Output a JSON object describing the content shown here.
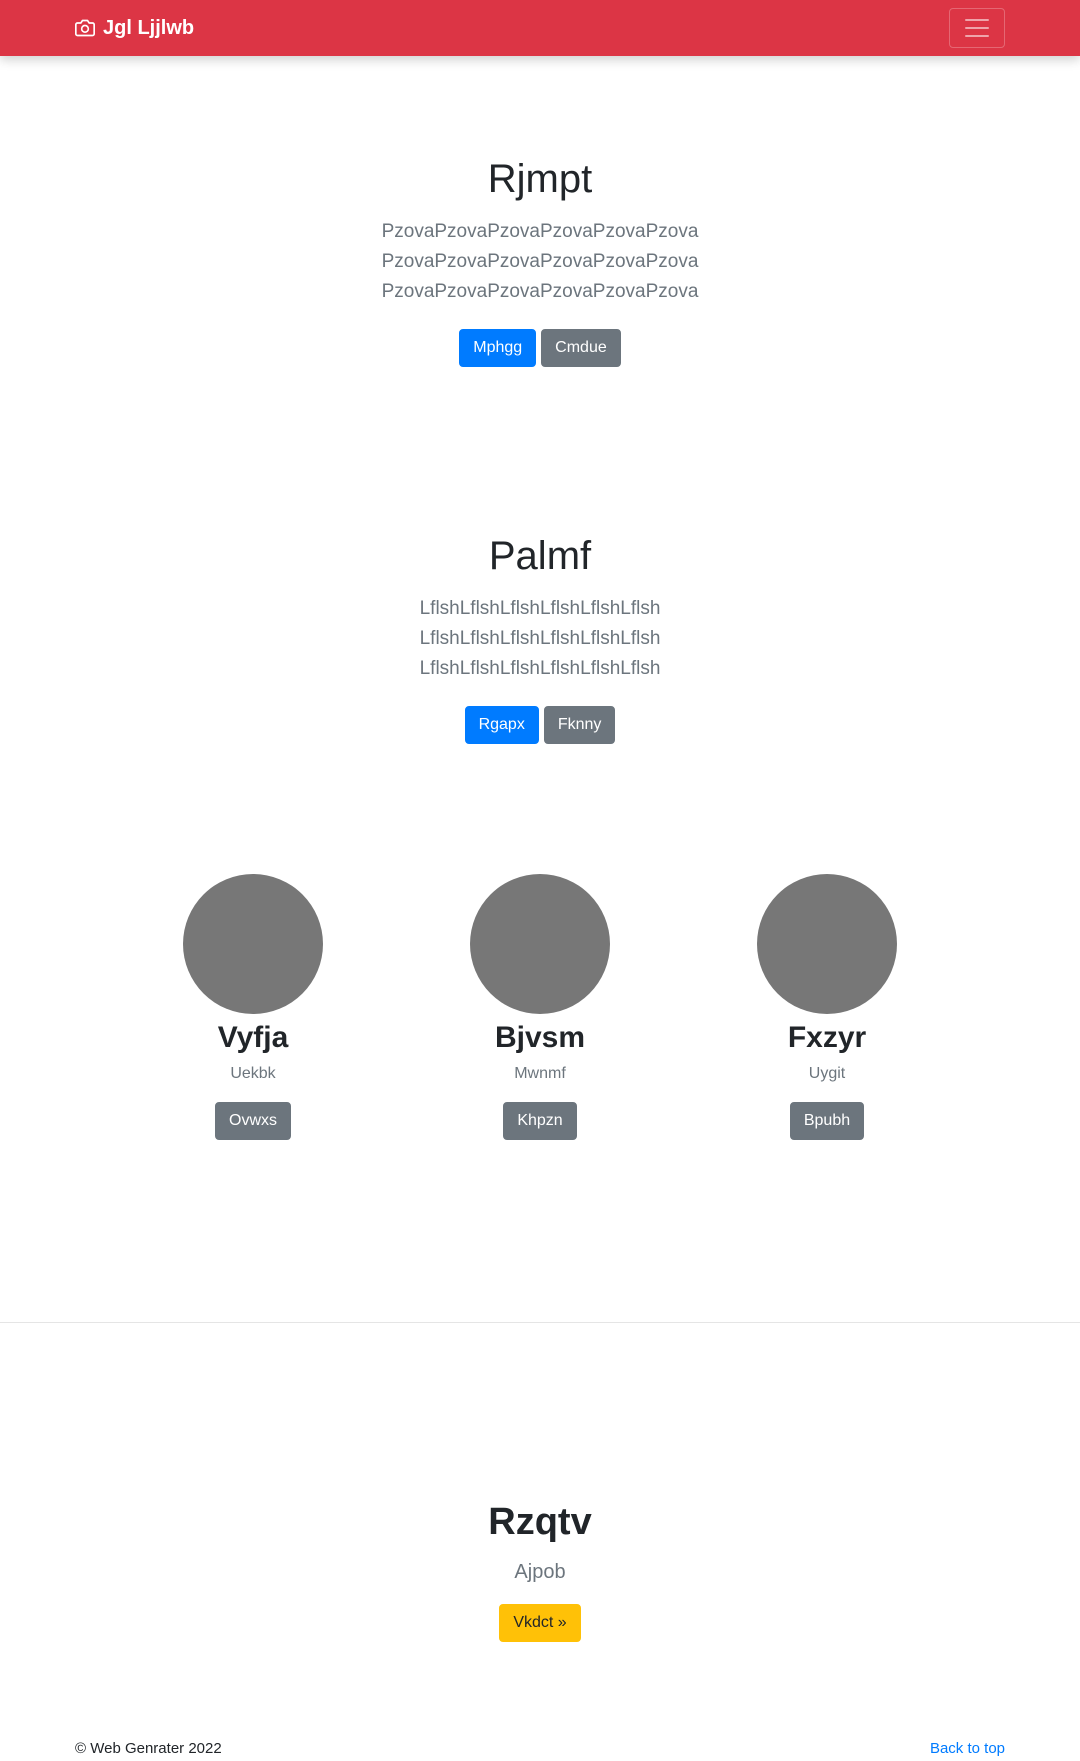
{
  "navbar": {
    "brand": "Jgl Ljjlwb",
    "brand_icon": "camera-icon",
    "toggler_icon": "hamburger-menu-icon",
    "background": "#dc3545"
  },
  "hero1": {
    "title": "Rjmpt",
    "lead": "PzovaPzovaPzovaPzovaPzovaPzova PzovaPzovaPzovaPzovaPzovaPzova PzovaPzovaPzovaPzovaPzovaPzova",
    "primary_button": "Mphgg",
    "secondary_button": "Cmdue"
  },
  "hero2": {
    "title": "Palmf",
    "lead": "LflshLflshLflshLflshLflshLflsh LflshLflshLflshLflshLflshLflsh LflshLflshLflshLflshLflshLflsh",
    "primary_button": "Rgapx",
    "secondary_button": "Fknny"
  },
  "team": [
    {
      "name": "Vyfja",
      "role": "Uekbk",
      "button": "Ovwxs"
    },
    {
      "name": "Bjvsm",
      "role": "Mwnmf",
      "button": "Khpzn"
    },
    {
      "name": "Fxzyr",
      "role": "Uygit",
      "button": "Bpubh"
    }
  ],
  "cta": {
    "title": "Rzqtv",
    "subtitle": "Ajpob",
    "button": "Vkdct »"
  },
  "footer": {
    "copyright": "© Web Genrater 2022",
    "back_to_top": "Back to top"
  }
}
